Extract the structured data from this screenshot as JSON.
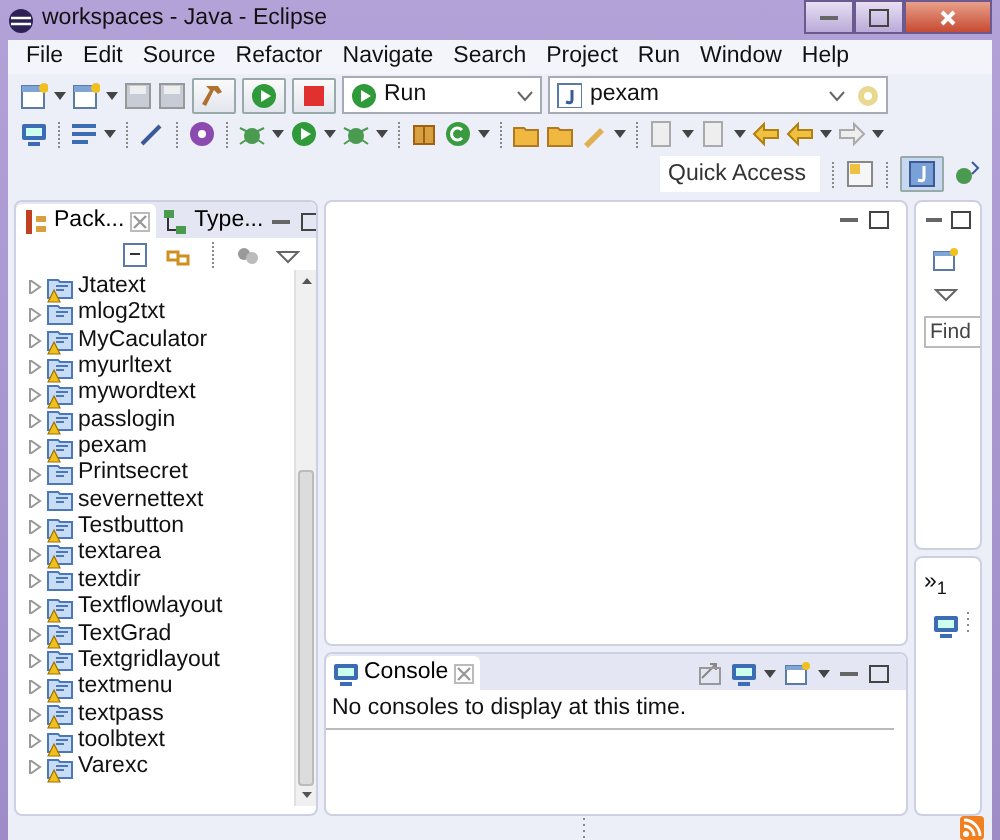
{
  "window": {
    "title": "workspaces - Java - Eclipse"
  },
  "menu": [
    "File",
    "Edit",
    "Source",
    "Refactor",
    "Navigate",
    "Search",
    "Project",
    "Run",
    "Window",
    "Help"
  ],
  "toolbar": {
    "launch_mode": "Run",
    "launch_config": "pexam",
    "quick_access": {
      "placeholder": "Quick Access"
    }
  },
  "package_explorer": {
    "tabs": [
      {
        "label": "Pack...",
        "selected": true
      },
      {
        "label": "Type...",
        "selected": false
      }
    ],
    "projects": [
      {
        "label": "Jtatext",
        "expanded": false,
        "warning": true
      },
      {
        "label": "mlog2txt",
        "expanded": false,
        "warning": false
      },
      {
        "label": "MyCaculator",
        "expanded": false,
        "warning": true
      },
      {
        "label": "myurltext",
        "expanded": false,
        "warning": true
      },
      {
        "label": "mywordtext",
        "expanded": false,
        "warning": true
      },
      {
        "label": "passlogin",
        "expanded": false,
        "warning": true
      },
      {
        "label": "pexam",
        "expanded": false,
        "warning": true
      },
      {
        "label": "Printsecret",
        "expanded": false,
        "warning": false
      },
      {
        "label": "severnettext",
        "expanded": false,
        "warning": false
      },
      {
        "label": "Testbutton",
        "expanded": false,
        "warning": true
      },
      {
        "label": "textarea",
        "expanded": false,
        "warning": true
      },
      {
        "label": "textdir",
        "expanded": false,
        "warning": false
      },
      {
        "label": "Textflowlayout",
        "expanded": false,
        "warning": true
      },
      {
        "label": "TextGrad",
        "expanded": false,
        "warning": true
      },
      {
        "label": "Textgridlayout",
        "expanded": false,
        "warning": true
      },
      {
        "label": "textmenu",
        "expanded": false,
        "warning": true
      },
      {
        "label": "textpass",
        "expanded": false,
        "warning": true
      },
      {
        "label": "toolbtext",
        "expanded": false,
        "warning": true
      },
      {
        "label": "Varexc",
        "expanded": false,
        "warning": true
      }
    ]
  },
  "outline": {
    "find": {
      "placeholder": "Find"
    },
    "overflow": "»",
    "overflow_count": "1"
  },
  "console": {
    "tab": "Console",
    "message": "No consoles to display at this time."
  }
}
